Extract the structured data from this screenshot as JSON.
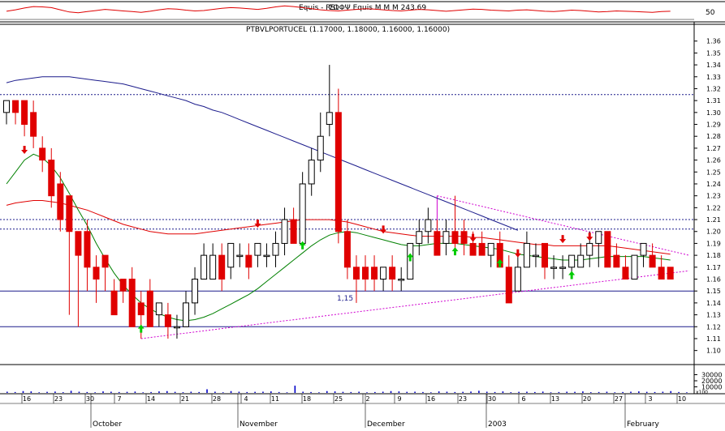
{
  "colors": {
    "background": "#ffffff",
    "up_candle": "#ffffff",
    "down_candle": "#e00000",
    "candle_outline": "#000000",
    "ma_short": "#008000",
    "ma_mid": "#e00000",
    "ma_long": "#1c1c8c",
    "hline": "#1c1c8c",
    "triangle": "#d000d0",
    "arrow_up": "#00cc00",
    "arrow_down": "#e00000",
    "volume": "#0000c8",
    "indicator": "#e00000",
    "grid": "#000000"
  },
  "chart_data": [
    {
      "type": "line",
      "panel": "indicator",
      "title": "Equis - RSI",
      "legend_overlap": "ΣΩΦΨ Equis Ⅿ Ⅿ Ⅿ 243.69",
      "ylim": [
        30,
        70
      ],
      "ytick_labels": [
        "50"
      ],
      "values": [
        48,
        52,
        57,
        61,
        60,
        58,
        52,
        46,
        44,
        47,
        50,
        53,
        51,
        49,
        47,
        45,
        48,
        52,
        55,
        54,
        51,
        49,
        50,
        53,
        56,
        58,
        57,
        55,
        53,
        56,
        60,
        63,
        61,
        58,
        55,
        52,
        50,
        49,
        51,
        53,
        55,
        54,
        52,
        50,
        49,
        51,
        53,
        52,
        50,
        48,
        50,
        52,
        54,
        53,
        51,
        50,
        49,
        51,
        52,
        50,
        48,
        47,
        49,
        51,
        50,
        48,
        46,
        47,
        49,
        48,
        47,
        46,
        45,
        47,
        48
      ]
    },
    {
      "type": "candlestick",
      "panel": "price",
      "title": "PTBVLPORTUCEL (1.17000, 1.18000, 1.16000, 1.16000)",
      "ylim": [
        1.095,
        1.37
      ],
      "ytick_labels": [
        "1.10",
        "1.11",
        "1.12",
        "1.13",
        "1.14",
        "1.15",
        "1.16",
        "1.17",
        "1.18",
        "1.19",
        "1.20",
        "1.21",
        "1.22",
        "1.23",
        "1.24",
        "1.25",
        "1.26",
        "1.27",
        "1.28",
        "1.29",
        "1.30",
        "1.31",
        "1.32",
        "1.33",
        "1.34",
        "1.35",
        "1.36"
      ],
      "xtick_labels": [
        "16",
        "23",
        "30",
        "7",
        "14",
        "21",
        "28",
        "4",
        "11",
        "18",
        "25",
        "2",
        "9",
        "16",
        "23",
        "30",
        "6",
        "13",
        "20",
        "27",
        "3",
        "10"
      ],
      "month_labels": [
        "October",
        "November",
        "December",
        "2003",
        "February"
      ],
      "hline_label": "1,15",
      "candles": [
        {
          "o": 1.3,
          "h": 1.31,
          "l": 1.29,
          "c": 1.31
        },
        {
          "o": 1.31,
          "h": 1.31,
          "l": 1.29,
          "c": 1.3
        },
        {
          "o": 1.31,
          "h": 1.31,
          "l": 1.28,
          "c": 1.29
        },
        {
          "o": 1.3,
          "h": 1.31,
          "l": 1.27,
          "c": 1.28
        },
        {
          "o": 1.27,
          "h": 1.28,
          "l": 1.25,
          "c": 1.26
        },
        {
          "o": 1.26,
          "h": 1.27,
          "l": 1.22,
          "c": 1.23
        },
        {
          "o": 1.24,
          "h": 1.25,
          "l": 1.2,
          "c": 1.21
        },
        {
          "o": 1.23,
          "h": 1.23,
          "l": 1.13,
          "c": 1.2
        },
        {
          "o": 1.2,
          "h": 1.2,
          "l": 1.12,
          "c": 1.18
        },
        {
          "o": 1.2,
          "h": 1.21,
          "l": 1.15,
          "c": 1.17
        },
        {
          "o": 1.17,
          "h": 1.18,
          "l": 1.14,
          "c": 1.16
        },
        {
          "o": 1.18,
          "h": 1.18,
          "l": 1.15,
          "c": 1.17
        },
        {
          "o": 1.15,
          "h": 1.16,
          "l": 1.14,
          "c": 1.13
        },
        {
          "o": 1.16,
          "h": 1.16,
          "l": 1.14,
          "c": 1.15
        },
        {
          "o": 1.16,
          "h": 1.17,
          "l": 1.12,
          "c": 1.12
        },
        {
          "o": 1.14,
          "h": 1.15,
          "l": 1.11,
          "c": 1.13
        },
        {
          "o": 1.15,
          "h": 1.16,
          "l": 1.12,
          "c": 1.12
        },
        {
          "o": 1.13,
          "h": 1.14,
          "l": 1.12,
          "c": 1.14
        },
        {
          "o": 1.13,
          "h": 1.14,
          "l": 1.11,
          "c": 1.12
        },
        {
          "o": 1.12,
          "h": 1.13,
          "l": 1.11,
          "c": 1.12
        },
        {
          "o": 1.12,
          "h": 1.15,
          "l": 1.12,
          "c": 1.14
        },
        {
          "o": 1.14,
          "h": 1.17,
          "l": 1.13,
          "c": 1.16
        },
        {
          "o": 1.16,
          "h": 1.19,
          "l": 1.16,
          "c": 1.18
        },
        {
          "o": 1.16,
          "h": 1.19,
          "l": 1.16,
          "c": 1.18
        },
        {
          "o": 1.18,
          "h": 1.19,
          "l": 1.15,
          "c": 1.16
        },
        {
          "o": 1.17,
          "h": 1.19,
          "l": 1.16,
          "c": 1.19
        },
        {
          "o": 1.18,
          "h": 1.19,
          "l": 1.17,
          "c": 1.18
        },
        {
          "o": 1.18,
          "h": 1.19,
          "l": 1.16,
          "c": 1.17
        },
        {
          "o": 1.18,
          "h": 1.19,
          "l": 1.17,
          "c": 1.19
        },
        {
          "o": 1.18,
          "h": 1.19,
          "l": 1.17,
          "c": 1.18
        },
        {
          "o": 1.18,
          "h": 1.2,
          "l": 1.17,
          "c": 1.19
        },
        {
          "o": 1.19,
          "h": 1.22,
          "l": 1.18,
          "c": 1.21
        },
        {
          "o": 1.21,
          "h": 1.22,
          "l": 1.19,
          "c": 1.19
        },
        {
          "o": 1.19,
          "h": 1.25,
          "l": 1.19,
          "c": 1.24
        },
        {
          "o": 1.24,
          "h": 1.27,
          "l": 1.23,
          "c": 1.26
        },
        {
          "o": 1.26,
          "h": 1.3,
          "l": 1.25,
          "c": 1.28
        },
        {
          "o": 1.29,
          "h": 1.34,
          "l": 1.28,
          "c": 1.3
        },
        {
          "o": 1.3,
          "h": 1.32,
          "l": 1.19,
          "c": 1.2
        },
        {
          "o": 1.2,
          "h": 1.21,
          "l": 1.16,
          "c": 1.17
        },
        {
          "o": 1.17,
          "h": 1.18,
          "l": 1.14,
          "c": 1.16
        },
        {
          "o": 1.17,
          "h": 1.18,
          "l": 1.15,
          "c": 1.16
        },
        {
          "o": 1.17,
          "h": 1.18,
          "l": 1.15,
          "c": 1.16
        },
        {
          "o": 1.16,
          "h": 1.17,
          "l": 1.15,
          "c": 1.17
        },
        {
          "o": 1.17,
          "h": 1.18,
          "l": 1.15,
          "c": 1.16
        },
        {
          "o": 1.16,
          "h": 1.17,
          "l": 1.15,
          "c": 1.16
        },
        {
          "o": 1.16,
          "h": 1.19,
          "l": 1.16,
          "c": 1.19
        },
        {
          "o": 1.19,
          "h": 1.21,
          "l": 1.18,
          "c": 1.2
        },
        {
          "o": 1.2,
          "h": 1.22,
          "l": 1.19,
          "c": 1.21
        },
        {
          "o": 1.2,
          "h": 1.21,
          "l": 1.18,
          "c": 1.18
        },
        {
          "o": 1.19,
          "h": 1.21,
          "l": 1.18,
          "c": 1.2
        },
        {
          "o": 1.2,
          "h": 1.23,
          "l": 1.18,
          "c": 1.19
        },
        {
          "o": 1.2,
          "h": 1.21,
          "l": 1.18,
          "c": 1.19
        },
        {
          "o": 1.19,
          "h": 1.2,
          "l": 1.18,
          "c": 1.18
        },
        {
          "o": 1.19,
          "h": 1.2,
          "l": 1.18,
          "c": 1.18
        },
        {
          "o": 1.18,
          "h": 1.19,
          "l": 1.17,
          "c": 1.19
        },
        {
          "o": 1.19,
          "h": 1.2,
          "l": 1.17,
          "c": 1.17
        },
        {
          "o": 1.17,
          "h": 1.18,
          "l": 1.14,
          "c": 1.14
        },
        {
          "o": 1.15,
          "h": 1.18,
          "l": 1.15,
          "c": 1.17
        },
        {
          "o": 1.17,
          "h": 1.2,
          "l": 1.17,
          "c": 1.19
        },
        {
          "o": 1.18,
          "h": 1.19,
          "l": 1.17,
          "c": 1.18
        },
        {
          "o": 1.19,
          "h": 1.19,
          "l": 1.16,
          "c": 1.17
        },
        {
          "o": 1.17,
          "h": 1.18,
          "l": 1.16,
          "c": 1.17
        },
        {
          "o": 1.17,
          "h": 1.18,
          "l": 1.16,
          "c": 1.17
        },
        {
          "o": 1.17,
          "h": 1.18,
          "l": 1.16,
          "c": 1.18
        },
        {
          "o": 1.17,
          "h": 1.19,
          "l": 1.17,
          "c": 1.18
        },
        {
          "o": 1.18,
          "h": 1.2,
          "l": 1.17,
          "c": 1.19
        },
        {
          "o": 1.19,
          "h": 1.2,
          "l": 1.17,
          "c": 1.2
        },
        {
          "o": 1.2,
          "h": 1.2,
          "l": 1.17,
          "c": 1.17
        },
        {
          "o": 1.18,
          "h": 1.19,
          "l": 1.17,
          "c": 1.17
        },
        {
          "o": 1.17,
          "h": 1.18,
          "l": 1.16,
          "c": 1.16
        },
        {
          "o": 1.16,
          "h": 1.18,
          "l": 1.16,
          "c": 1.18
        },
        {
          "o": 1.18,
          "h": 1.19,
          "l": 1.17,
          "c": 1.19
        },
        {
          "o": 1.18,
          "h": 1.19,
          "l": 1.17,
          "c": 1.17
        },
        {
          "o": 1.17,
          "h": 1.18,
          "l": 1.16,
          "c": 1.16
        },
        {
          "o": 1.17,
          "h": 1.17,
          "l": 1.16,
          "c": 1.16
        }
      ],
      "ma_short": [
        1.24,
        1.25,
        1.26,
        1.265,
        1.262,
        1.255,
        1.245,
        1.232,
        1.218,
        1.205,
        1.19,
        1.177,
        1.165,
        1.155,
        1.147,
        1.14,
        1.135,
        1.131,
        1.128,
        1.126,
        1.125,
        1.126,
        1.128,
        1.131,
        1.135,
        1.139,
        1.143,
        1.147,
        1.152,
        1.158,
        1.164,
        1.17,
        1.176,
        1.182,
        1.188,
        1.193,
        1.197,
        1.199,
        1.2,
        1.199,
        1.197,
        1.195,
        1.193,
        1.191,
        1.189,
        1.188,
        1.188,
        1.189,
        1.19,
        1.19,
        1.19,
        1.189,
        1.188,
        1.187,
        1.186,
        1.185,
        1.183,
        1.181,
        1.18,
        1.179,
        1.178,
        1.177,
        1.176,
        1.176,
        1.176,
        1.177,
        1.178,
        1.179,
        1.179,
        1.179,
        1.179,
        1.179,
        1.178,
        1.177,
        1.176
      ],
      "ma_mid": [
        1.222,
        1.224,
        1.225,
        1.226,
        1.226,
        1.225,
        1.224,
        1.222,
        1.22,
        1.218,
        1.215,
        1.212,
        1.209,
        1.206,
        1.204,
        1.202,
        1.2,
        1.199,
        1.198,
        1.198,
        1.198,
        1.198,
        1.199,
        1.2,
        1.201,
        1.202,
        1.203,
        1.204,
        1.205,
        1.206,
        1.207,
        1.208,
        1.209,
        1.21,
        1.21,
        1.21,
        1.21,
        1.209,
        1.208,
        1.206,
        1.204,
        1.202,
        1.2,
        1.199,
        1.198,
        1.197,
        1.196,
        1.196,
        1.196,
        1.196,
        1.196,
        1.196,
        1.195,
        1.195,
        1.194,
        1.193,
        1.192,
        1.191,
        1.19,
        1.189,
        1.189,
        1.188,
        1.188,
        1.188,
        1.188,
        1.188,
        1.188,
        1.188,
        1.187,
        1.186,
        1.185,
        1.184,
        1.183,
        1.182,
        1.181
      ],
      "ma_long": [
        1.325,
        1.327,
        1.328,
        1.329,
        1.33,
        1.33,
        1.33,
        1.33,
        1.329,
        1.328,
        1.327,
        1.326,
        1.325,
        1.324,
        1.322,
        1.32,
        1.318,
        1.316,
        1.314,
        1.312,
        1.31,
        1.307,
        1.305,
        1.302,
        1.3,
        1.297,
        1.294,
        1.291,
        1.288,
        1.285,
        1.282,
        1.279,
        1.276,
        1.273,
        1.27,
        1.267,
        1.264,
        1.261,
        1.258,
        1.255,
        1.252,
        1.249,
        1.246,
        1.243,
        1.24,
        1.237,
        1.234,
        1.231,
        1.228,
        1.225,
        1.222,
        1.219,
        1.216,
        1.213,
        1.21,
        1.207,
        1.204,
        1.201
      ]
    },
    {
      "type": "bar",
      "panel": "volume",
      "ytick_labels": [
        "30000",
        "20000",
        "10000"
      ],
      "scale_label": "x100",
      "ylim": [
        0,
        40000
      ],
      "values": [
        2000,
        1500,
        3000,
        2500,
        1000,
        1800,
        2200,
        1200,
        3500,
        2000,
        1500,
        1000,
        2500,
        2000,
        1500,
        1800,
        2200,
        1000,
        1500,
        2500,
        3000,
        1800,
        1200,
        2000,
        1500,
        6000,
        2000,
        1000,
        3000,
        2000,
        1500,
        1800,
        2000,
        2500,
        1500,
        1000,
        12000,
        2000,
        1500,
        1000,
        3000,
        2500,
        1800,
        1500,
        2000,
        1000,
        1500,
        2000,
        3000,
        2500,
        1800,
        2000,
        1500,
        1000,
        2500,
        2000,
        1500,
        1800,
        2200,
        3500,
        2000,
        1500,
        2500,
        1200,
        1800,
        2000,
        1500,
        2200,
        1000,
        1500,
        2000,
        1800,
        2500,
        1200,
        1500,
        2000,
        1000,
        1500,
        2000,
        2500,
        1800,
        1500,
        2000,
        3000,
        1500,
        1000
      ]
    }
  ],
  "overlays": {
    "hline_dotted": [
      1.315,
      1.21,
      1.202
    ],
    "hline_solid": [
      1.15,
      1.12
    ],
    "triangle_upper": [
      [
        48,
        1.23
      ],
      [
        75,
        1.18
      ]
    ],
    "triangle_lower": [
      [
        15,
        1.11
      ],
      [
        75,
        1.167
      ]
    ],
    "arrows_up": [
      [
        15,
        1.115
      ],
      [
        33,
        1.185
      ],
      [
        45,
        1.175
      ],
      [
        50,
        1.18
      ],
      [
        55,
        1.17
      ],
      [
        63,
        1.16
      ]
    ],
    "arrows_down": [
      [
        2,
        1.272
      ],
      [
        28,
        1.21
      ],
      [
        42,
        1.205
      ],
      [
        52,
        1.198
      ],
      [
        57,
        1.185
      ],
      [
        62,
        1.197
      ],
      [
        65,
        1.199
      ]
    ]
  }
}
